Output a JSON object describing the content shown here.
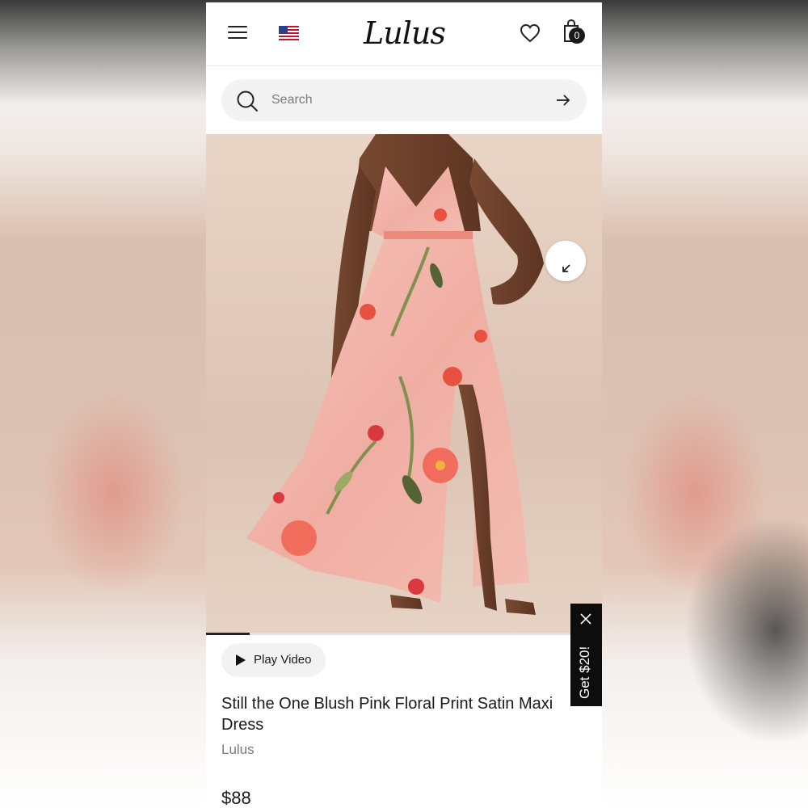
{
  "header": {
    "logo_text": "Lulus",
    "cart_count": "0",
    "flag": "us-flag-icon"
  },
  "search": {
    "placeholder": "Search"
  },
  "product": {
    "image": "product-photo-floral-maxi-dress",
    "gallery_progress": 0.11,
    "play_video_label": "Play Video",
    "title": "Still the One Blush Pink Floral Print Satin Maxi Dress",
    "brand": "Lulus",
    "price": "$88"
  },
  "promo": {
    "label": "Get $20!"
  },
  "colors": {
    "accent": "#111111",
    "dress_pink": "#f2b6ae",
    "flower_red": "#e84b3a"
  }
}
